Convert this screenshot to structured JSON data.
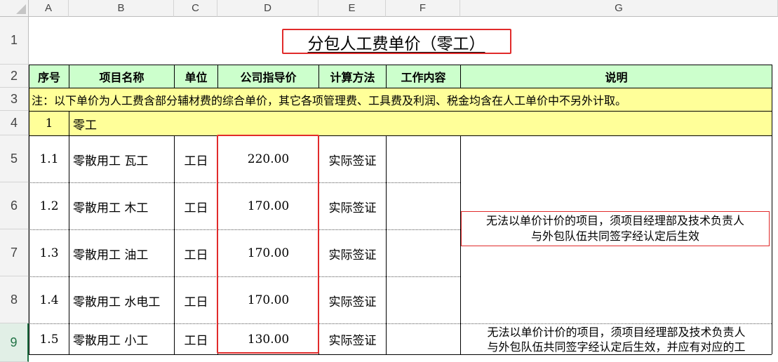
{
  "columns": [
    "A",
    "B",
    "C",
    "D",
    "E",
    "F",
    "G"
  ],
  "rows": [
    "1",
    "2",
    "3",
    "4",
    "5",
    "6",
    "7",
    "8",
    "9"
  ],
  "title": "分包人工费单价（零工）",
  "headers": {
    "seq": "序号",
    "name": "项目名称",
    "unit": "单位",
    "price": "公司指导价",
    "method": "计算方法",
    "content": "工作内容",
    "desc": "说明"
  },
  "note": "注：以下单价为人工费含部分辅材费的综合单价，其它各项管理费、工具费及利润、税金均含在人工单价中不另外计取。",
  "section": {
    "seq": "1",
    "name": "零工"
  },
  "items": [
    {
      "seq": "1.1",
      "name": "零散用工  瓦工",
      "unit": "工日",
      "price": "220.00",
      "method": "实际签证"
    },
    {
      "seq": "1.2",
      "name": "零散用工  木工",
      "unit": "工日",
      "price": "170.00",
      "method": "实际签证"
    },
    {
      "seq": "1.3",
      "name": "零散用工  油工",
      "unit": "工日",
      "price": "170.00",
      "method": "实际签证"
    },
    {
      "seq": "1.4",
      "name": "零散用工  水电工",
      "unit": "工日",
      "price": "170.00",
      "method": "实际签证"
    },
    {
      "seq": "1.5",
      "name": "零散用工  小工",
      "unit": "工日",
      "price": "130.00",
      "method": "实际签证"
    }
  ],
  "desc_merged_line1": "无法以单价计价的项目，须项目经理部及技术负责人",
  "desc_merged_line2": "与外包队伍共同签字经认定后生效",
  "desc_row9_line1": "无法以单价计价的项目，须项目经理部及技术负责人",
  "desc_row9_line2": "与外包队伍共同签字经认定后生效，并应有对应的工",
  "colors": {
    "header_fill": "#ccffcc",
    "note_fill": "#ffff99",
    "highlight_box": "#e12b2b",
    "selected_row": "#217346"
  }
}
